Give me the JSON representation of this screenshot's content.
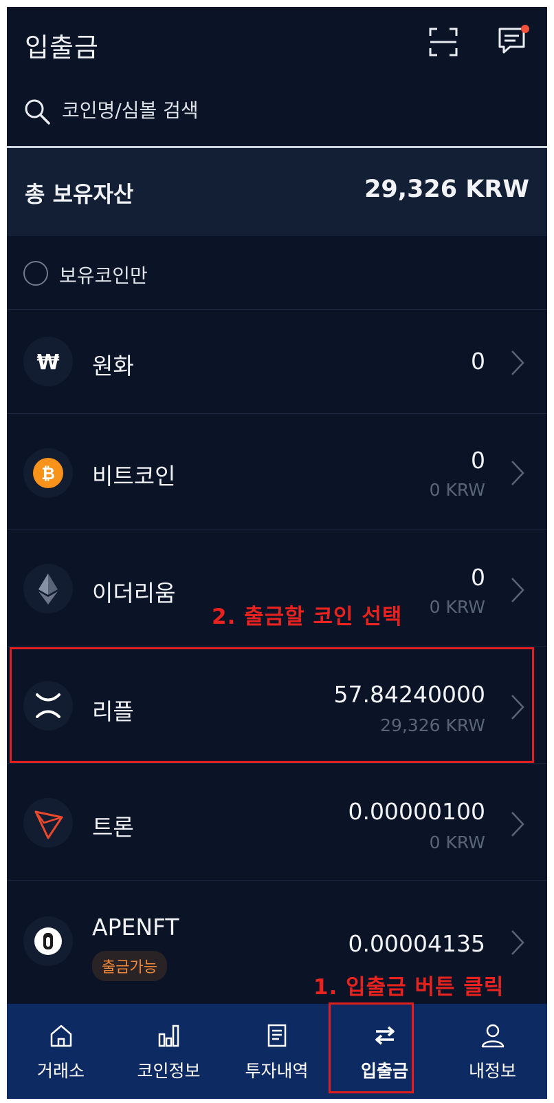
{
  "header": {
    "title": "입출금",
    "scan_icon": "scan-icon",
    "chat_icon": "chat-icon"
  },
  "search": {
    "placeholder": "코인명/심볼 검색",
    "value": ""
  },
  "total": {
    "label": "총 보유자산",
    "value": "29,326 KRW"
  },
  "filter": {
    "label": "보유코인만",
    "checked": false
  },
  "coins": [
    {
      "name": "원화",
      "icon": "won-icon",
      "amount": "0",
      "krw": ""
    },
    {
      "name": "비트코인",
      "icon": "bitcoin-icon",
      "amount": "0",
      "krw": "0 KRW"
    },
    {
      "name": "이더리움",
      "icon": "ethereum-icon",
      "amount": "0",
      "krw": "0 KRW"
    },
    {
      "name": "리플",
      "icon": "ripple-icon",
      "amount": "57.84240000",
      "krw": "29,326 KRW"
    },
    {
      "name": "트론",
      "icon": "tron-icon",
      "amount": "0.00000100",
      "krw": "0 KRW"
    },
    {
      "name": "APENFT",
      "icon": "apenft-icon",
      "amount": "0.00004135",
      "krw": "",
      "badge": "출금가능"
    }
  ],
  "annotations": {
    "step2": "2. 출금할 코인 선택",
    "step1": "1. 입출금 버튼 클릭"
  },
  "nav": [
    {
      "label": "거래소",
      "icon": "home-icon"
    },
    {
      "label": "코인정보",
      "icon": "bar-chart-icon"
    },
    {
      "label": "투자내역",
      "icon": "document-icon"
    },
    {
      "label": "입출금",
      "icon": "transfer-icon",
      "active": true
    },
    {
      "label": "내정보",
      "icon": "user-icon"
    }
  ],
  "colors": {
    "background": "#0b1427",
    "nav_background": "#0e2a63",
    "annotation_red": "#e8221e",
    "badge_orange": "#f0883a"
  }
}
